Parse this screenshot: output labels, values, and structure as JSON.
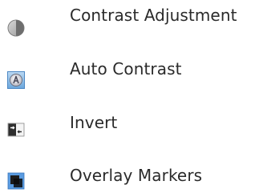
{
  "menu": {
    "items": [
      {
        "label": "Contrast Adjustment",
        "icon": "contrast-adjustment-icon"
      },
      {
        "label": "Auto Contrast",
        "icon": "auto-contrast-icon"
      },
      {
        "label": "Invert",
        "icon": "invert-icon"
      },
      {
        "label": "Overlay Markers",
        "icon": "overlay-markers-icon"
      }
    ]
  },
  "colors": {
    "text": "#2a2a2a",
    "background": "#ffffff",
    "icon_blue": "#4a8fd4",
    "icon_gray": "#8a8a8a"
  }
}
